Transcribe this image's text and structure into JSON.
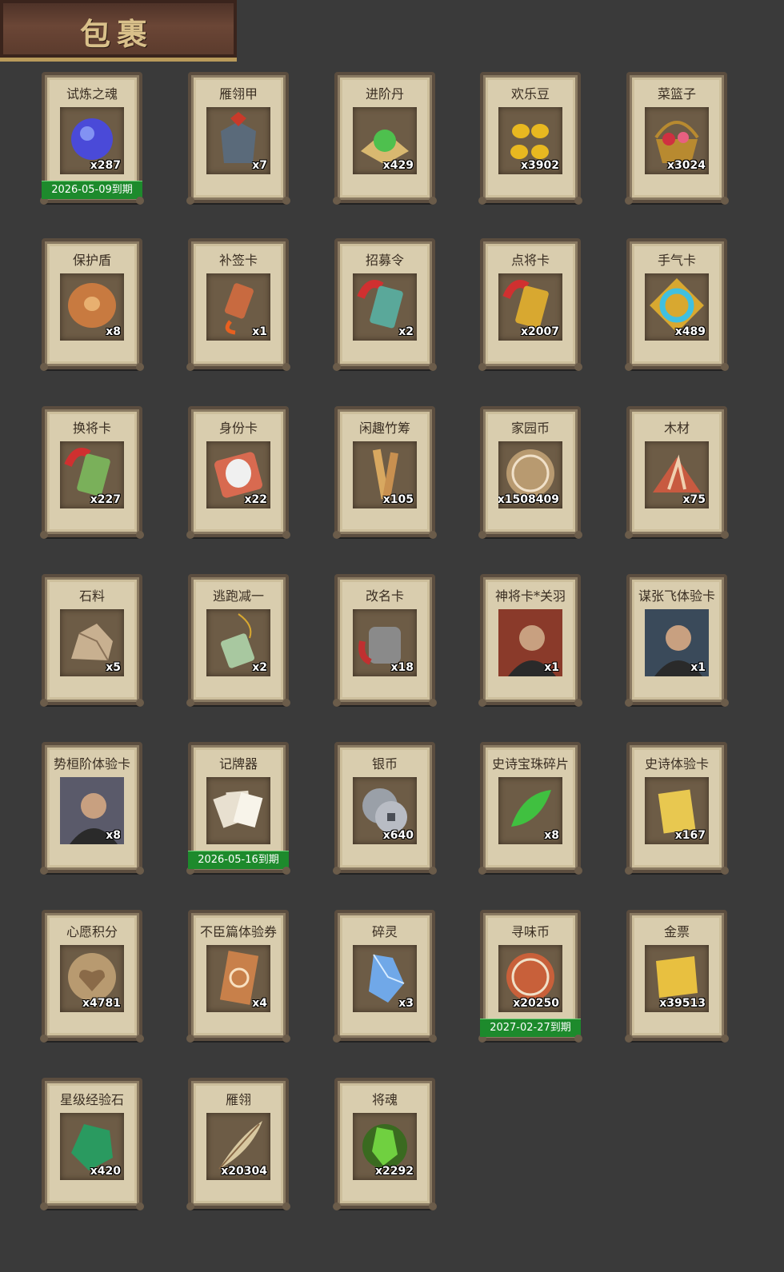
{
  "header": {
    "title": "包裹"
  },
  "items": [
    {
      "name": "试炼之魂",
      "count": "x287",
      "expiry": "2026-05-09到期",
      "icon": "orb-icon",
      "color": "#4a4ad8"
    },
    {
      "name": "雁翎甲",
      "count": "x7",
      "icon": "armor-icon",
      "color": "#5a6a7a"
    },
    {
      "name": "进阶丹",
      "count": "x429",
      "icon": "pill-icon",
      "color": "#4ec04e"
    },
    {
      "name": "欢乐豆",
      "count": "x3902",
      "icon": "beans-icon",
      "color": "#e8b820"
    },
    {
      "name": "菜篮子",
      "count": "x3024",
      "icon": "basket-icon",
      "color": "#b88a30"
    },
    {
      "name": "保护盾",
      "count": "x8",
      "icon": "shield-icon",
      "color": "#c87a40"
    },
    {
      "name": "补签卡",
      "count": "x1",
      "icon": "tag-icon",
      "color": "#c86a40"
    },
    {
      "name": "招募令",
      "count": "x2",
      "icon": "token-icon",
      "color": "#5aa89a"
    },
    {
      "name": "点将卡",
      "count": "x2007",
      "icon": "token-icon",
      "color": "#d8a830"
    },
    {
      "name": "手气卡",
      "count": "x489",
      "icon": "ring-icon",
      "color": "#40c0e0"
    },
    {
      "name": "换将卡",
      "count": "x227",
      "icon": "token-icon",
      "color": "#7ab05a"
    },
    {
      "name": "身份卡",
      "count": "x22",
      "icon": "mask-icon",
      "color": "#d86a50"
    },
    {
      "name": "闲趣竹筹",
      "count": "x105",
      "icon": "bamboo-icon",
      "color": "#d8a860"
    },
    {
      "name": "家园币",
      "count": "x1508409",
      "icon": "coin-icon",
      "color": "#b89a70"
    },
    {
      "name": "木材",
      "count": "x75",
      "icon": "wood-icon",
      "color": "#c85a40"
    },
    {
      "name": "石料",
      "count": "x5",
      "icon": "stone-icon",
      "color": "#c8b090"
    },
    {
      "name": "逃跑减一",
      "count": "x2",
      "icon": "jade-icon",
      "color": "#a8c8a0"
    },
    {
      "name": "改名卡",
      "count": "x18",
      "icon": "nameplate-icon",
      "color": "#8a8a8a"
    },
    {
      "name": "神将卡*关羽",
      "count": "x1",
      "icon": "general-portrait-icon",
      "color": "#8a3a2a"
    },
    {
      "name": "谋张飞体验卡",
      "count": "x1",
      "icon": "general-portrait-icon",
      "color": "#3a4a5a"
    },
    {
      "name": "势桓阶体验卡",
      "count": "x8",
      "icon": "general-portrait-icon",
      "color": "#5a5a6a"
    },
    {
      "name": "记牌器",
      "count": "",
      "expiry": "2026-05-16到期",
      "icon": "cards-icon",
      "color": "#e8e0d0"
    },
    {
      "name": "银币",
      "count": "x640",
      "icon": "silver-coin-icon",
      "color": "#9aa0a8"
    },
    {
      "name": "史诗宝珠碎片",
      "count": "x8",
      "icon": "leaf-gem-icon",
      "color": "#40c040"
    },
    {
      "name": "史诗体验卡",
      "count": "x167",
      "icon": "gold-card-icon",
      "color": "#e8c850"
    },
    {
      "name": "心愿积分",
      "count": "x4781",
      "icon": "heart-coin-icon",
      "color": "#b89a70"
    },
    {
      "name": "不臣篇体验券",
      "count": "x4",
      "icon": "ticket-icon",
      "color": "#c8804a"
    },
    {
      "name": "碎灵",
      "count": "x3",
      "icon": "crystal-icon",
      "color": "#70a8e8"
    },
    {
      "name": "寻味币",
      "count": "x20250",
      "expiry": "2027-02-27到期",
      "icon": "coin-icon",
      "color": "#c8603a"
    },
    {
      "name": "金票",
      "count": "x39513",
      "icon": "scroll-icon",
      "color": "#e8c040"
    },
    {
      "name": "星级经验石",
      "count": "x420",
      "icon": "green-stone-icon",
      "color": "#2a9a60"
    },
    {
      "name": "雁翎",
      "count": "x20304",
      "icon": "feather-icon",
      "color": "#d8c8a0"
    },
    {
      "name": "将魂",
      "count": "x2292",
      "icon": "soul-gem-icon",
      "color": "#70d040"
    }
  ]
}
